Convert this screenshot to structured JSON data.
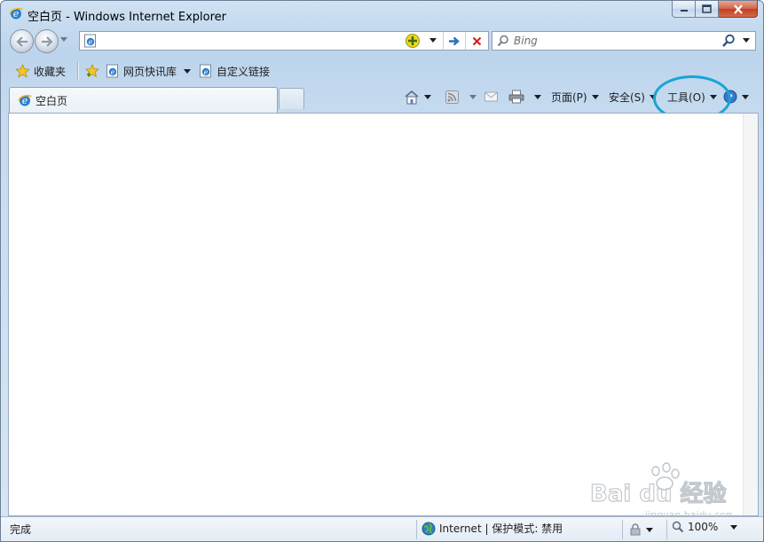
{
  "window": {
    "title": "空白页 - Windows Internet Explorer"
  },
  "address_bar": {
    "url": "",
    "placeholder": ""
  },
  "search": {
    "placeholder": "Bing"
  },
  "favorites_bar": {
    "favorites_label": "收藏夹",
    "web_slice_label": "网页快讯库",
    "custom_links_label": "自定义链接"
  },
  "tabs": [
    {
      "label": "空白页"
    }
  ],
  "command_bar": {
    "page_label": "页面(P)",
    "safety_label": "安全(S)",
    "tools_label": "工具(O)"
  },
  "status_bar": {
    "status_text": "完成",
    "zone_text": "Internet | 保护模式: 禁用",
    "zoom_text": "100%"
  },
  "watermark": {
    "logo_text": "Bai du 经验",
    "url_text": "jingyan.baidu.com"
  },
  "colors": {
    "highlight_ring": "#1aa2d6",
    "ie_blue": "#2a7fd0",
    "ie_ring": "#f2b51d",
    "stop_red": "#d42323",
    "go_blue": "#2d6fbf"
  },
  "icons": {
    "ie_logo": "ie-logo-icon",
    "back": "back-arrow-icon",
    "forward": "forward-arrow-icon",
    "compat": "compatibility-view-icon",
    "go": "go-arrow-icon",
    "stop": "stop-icon",
    "search": "magnifier-icon",
    "favorites": "star-icon",
    "add_favorites": "add-favorites-icon",
    "home": "home-icon",
    "feeds": "rss-feed-icon",
    "mail": "mail-icon",
    "print": "printer-icon",
    "help": "help-icon",
    "globe": "globe-icon",
    "zoom": "magnifier-icon"
  }
}
